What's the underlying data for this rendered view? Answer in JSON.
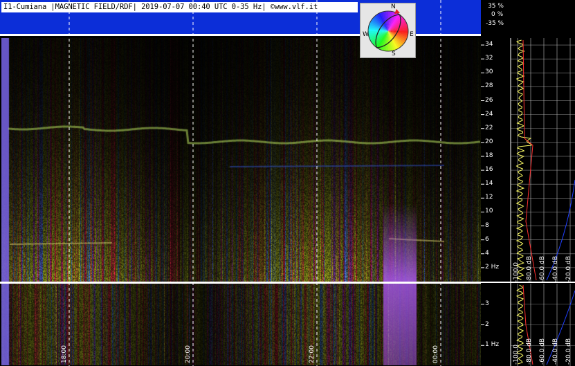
{
  "header": {
    "title": "I1-Cumiana |MAGNETIC FIELD/RDF| 2019-07-07 00:40 UTC 0-35 Hz| ©www.vlf.it"
  },
  "rdf_scale": [
    "35 %",
    "0 %",
    "-35 %"
  ],
  "freq_axis_upper": [
    "34",
    "32",
    "30",
    "28",
    "26",
    "24",
    "22",
    "20",
    "18",
    "16",
    "14",
    "12",
    "10",
    "8",
    "6",
    "4",
    "2 Hz"
  ],
  "freq_axis_lower": [
    "3",
    "2",
    "1 Hz"
  ],
  "time_axis": [
    "18:00",
    "20:00",
    "22:00",
    "00:00"
  ],
  "db_axis_upper": [
    "-100.0",
    "-80.0 dB",
    "-60.0 dB",
    "-40.0 dB",
    "-20.0 dB"
  ],
  "db_axis_lower": [
    "-100.0",
    "-80.0 dB",
    "-60.0 dB",
    "-40.0 dB",
    "-20.0 dB"
  ],
  "compass": {
    "n": "N",
    "s": "S",
    "e": "E",
    "w": "W"
  },
  "colors": {
    "band": "#0c2ed8",
    "grid": "#ffffff",
    "trace": "#ffff66",
    "ref": "#ff3030"
  }
}
